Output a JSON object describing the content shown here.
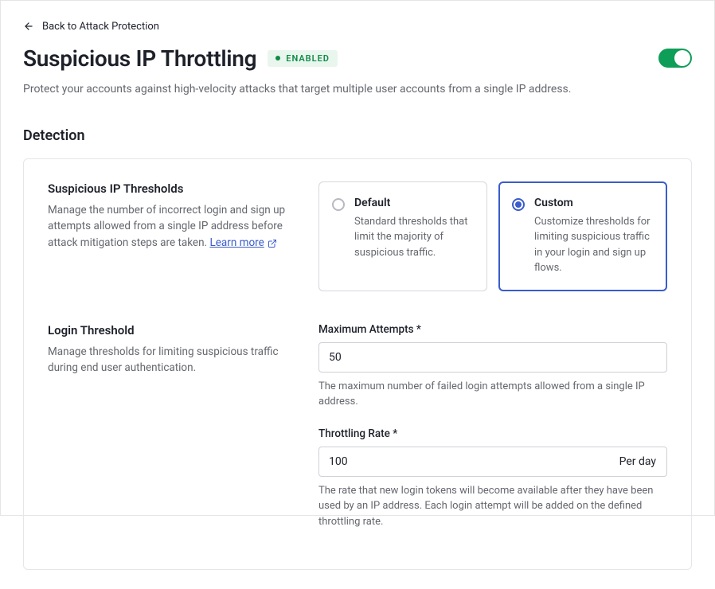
{
  "back_link": "Back to Attack Protection",
  "title": "Suspicious IP Throttling",
  "status_badge": "ENABLED",
  "subtitle": "Protect your accounts against high-velocity attacks that target multiple user accounts from a single IP address.",
  "section_title": "Detection",
  "thresholds": {
    "heading": "Suspicious IP Thresholds",
    "desc_prefix": "Manage the number of incorrect login and sign up attempts allowed from a single IP address before attack mitigation steps are taken. ",
    "learn_more": "Learn more",
    "options": {
      "default": {
        "title": "Default",
        "desc": "Standard thresholds that limit the majority of suspicious traffic."
      },
      "custom": {
        "title": "Custom",
        "desc": "Customize thresholds for limiting suspicious traffic in your login and sign up flows."
      }
    }
  },
  "login_threshold": {
    "heading": "Login Threshold",
    "desc": "Manage thresholds for limiting suspicious traffic during end user authentication.",
    "max_attempts": {
      "label": "Maximum Attempts *",
      "value": "50",
      "help": "The maximum number of failed login attempts allowed from a single IP address."
    },
    "throttling_rate": {
      "label": "Throttling Rate *",
      "value": "100",
      "suffix": "Per day",
      "help": "The rate that new login tokens will become available after they have been used by an IP address. Each login attempt will be added on the defined throttling rate."
    }
  }
}
